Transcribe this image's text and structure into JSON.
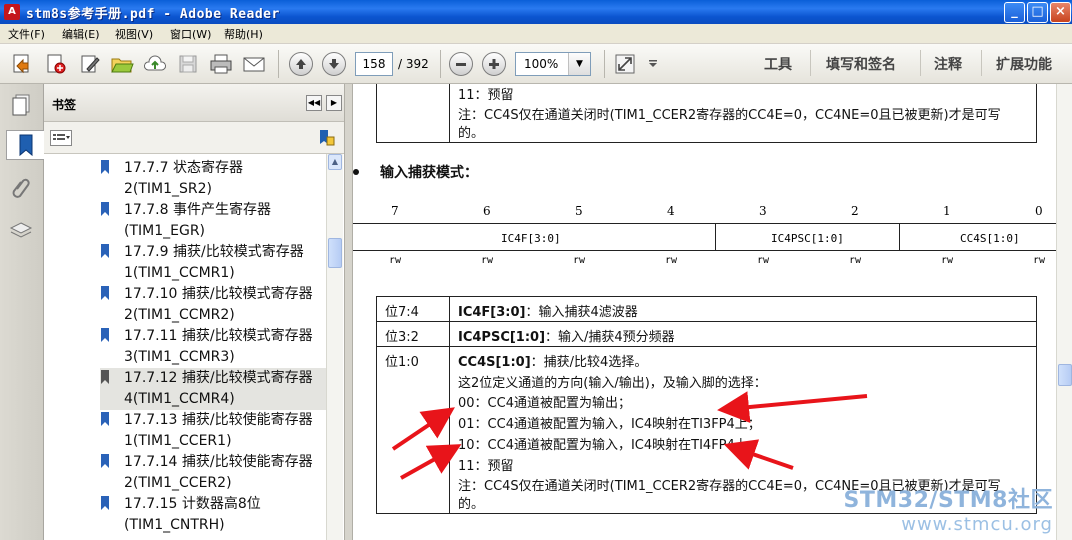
{
  "window": {
    "title": "stm8s参考手册.pdf - Adobe Reader",
    "app_icon": "pdf-icon"
  },
  "menu": [
    "文件(F)",
    "编辑(E)",
    "视图(V)",
    "窗口(W)",
    "帮助(H)"
  ],
  "toolbar": {
    "page_current": "158",
    "page_total": "/ 392",
    "zoom": "100%",
    "links": [
      "工具",
      "填写和签名",
      "注释",
      "扩展功能"
    ]
  },
  "bookmarks": {
    "title": "书签",
    "items": [
      {
        "line1": "17.7.7 状态寄存器",
        "line2": "2(TIM1_SR2)"
      },
      {
        "line1": "17.7.8 事件产生寄存器",
        "line2": "(TIM1_EGR)"
      },
      {
        "line1": "17.7.9 捕获/比较模式寄存器",
        "line2": "1(TIM1_CCMR1)"
      },
      {
        "line1": "17.7.10 捕获/比较模式寄存器",
        "line2": "2(TIM1_CCMR2)"
      },
      {
        "line1": "17.7.11 捕获/比较模式寄存器",
        "line2": "3(TIM1_CCMR3)"
      },
      {
        "line1": "17.7.12 捕获/比较模式寄存器",
        "line2": "4(TIM1_CCMR4)",
        "selected": true
      },
      {
        "line1": "17.7.13 捕获/比较使能寄存器",
        "line2": "1(TIM1_CCER1)"
      },
      {
        "line1": "17.7.14 捕获/比较使能寄存器",
        "line2": "2(TIM1_CCER2)"
      },
      {
        "line1": "17.7.15 计数器高8位",
        "line2": "(TIM1_CNTRH)"
      }
    ]
  },
  "doc": {
    "top_box": {
      "line1": "11：预留",
      "line2": "注：CC4S仅在通道关闭时(TIM1_CCER2寄存器的CC4E=0，CC4NE=0且已被更新)才是可写",
      "line3": "的。"
    },
    "section_title": "输入捕获模式：",
    "bit_numbers": [
      "7",
      "6",
      "5",
      "4",
      "3",
      "2",
      "1",
      "0"
    ],
    "fields": [
      "IC4F[3:0]",
      "IC4PSC[1:0]",
      "CC4S[1:0]"
    ],
    "access": [
      "rw",
      "rw",
      "rw",
      "rw",
      "rw",
      "rw",
      "rw",
      "rw"
    ],
    "table": {
      "row1": {
        "bits": "位7:4",
        "name": "IC4F[3:0]",
        "desc": "：输入捕获4滤波器"
      },
      "row2": {
        "bits": "位3:2",
        "name": "IC4PSC[1:0]",
        "desc": "：输入/捕获4预分频器"
      },
      "row3": {
        "bits": "位1:0",
        "name": "CC4S[1:0]",
        "desc": "：捕获/比较4选择。",
        "l1": "这2位定义通道的方向(输入/输出)，及输入脚的选择：",
        "l2": "00：CC4通道被配置为输出；",
        "l3": "01：CC4通道被配置为输入，IC4映射在TI3FP4上；",
        "l4": "10：CC4通道被配置为输入，IC4映射在TI4FP4上；",
        "l5": "11：预留",
        "l6": "注：CC4S仅在通道关闭时(TIM1_CCER2寄存器的CC4E=0，CC4NE=0且已被更新)才是可写",
        "l7": "的。"
      }
    },
    "watermark": {
      "line1": "STM32/STM8社区",
      "line2": "www.stmcu.org"
    },
    "annotation_color": "#e8141a"
  }
}
